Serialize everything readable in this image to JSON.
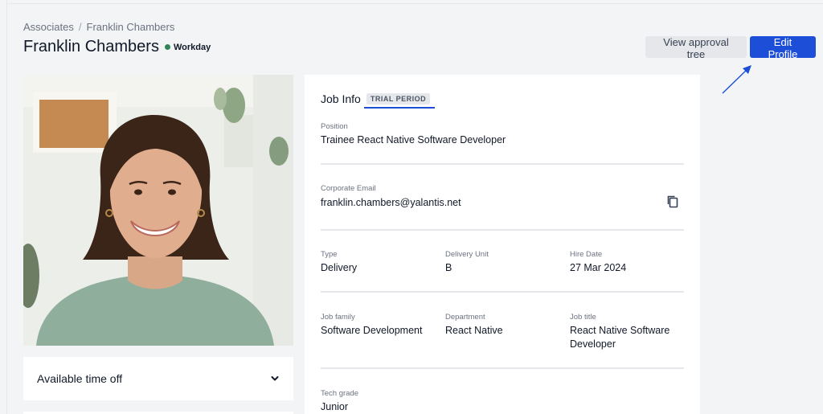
{
  "breadcrumb": {
    "parent": "Associates",
    "separator": "/",
    "current": "Franklin Chambers"
  },
  "header": {
    "name": "Franklin Chambers",
    "status": "Workday",
    "status_color": "#2f855a"
  },
  "actions": {
    "view_approval_tree": "View approval tree",
    "edit_profile": "Edit Profile"
  },
  "colors": {
    "accent": "#1d4ed8",
    "background": "#f3f4f6"
  },
  "time_off": {
    "label": "Available time off",
    "toggle_icon": "chevron-down-icon"
  },
  "job_info": {
    "title": "Job Info",
    "badge": "TRIAL PERIOD",
    "position": {
      "label": "Position",
      "value": "Trainee React Native Software Developer"
    },
    "corporate_email": {
      "label": "Corporate Email",
      "value": "franklin.chambers@yalantis.net",
      "action_icon": "copy-icon"
    },
    "type": {
      "label": "Type",
      "value": "Delivery"
    },
    "delivery_unit": {
      "label": "Delivery Unit",
      "value": "B"
    },
    "hire_date": {
      "label": "Hire Date",
      "value": "27 Mar 2024"
    },
    "job_family": {
      "label": "Job family",
      "value": "Software Development"
    },
    "department": {
      "label": "Department",
      "value": "React Native"
    },
    "job_title": {
      "label": "Job title",
      "value_line1": "React Native Software",
      "value_line2": "Developer"
    },
    "tech_grade": {
      "label": "Tech grade",
      "value": "Junior"
    }
  }
}
